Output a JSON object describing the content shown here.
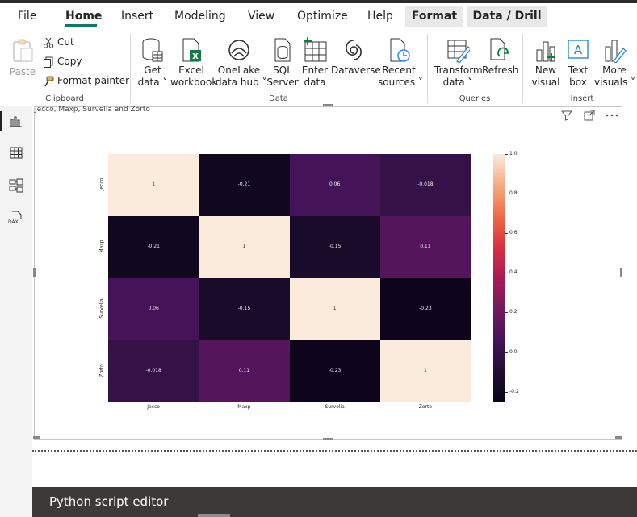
{
  "menu": {
    "tabs": [
      {
        "label": "File"
      },
      {
        "label": "Home"
      },
      {
        "label": "Insert"
      },
      {
        "label": "Modeling"
      },
      {
        "label": "View"
      },
      {
        "label": "Optimize"
      },
      {
        "label": "Help"
      },
      {
        "label": "Format"
      },
      {
        "label": "Data / Drill"
      }
    ],
    "active_tab": "Home"
  },
  "ribbon": {
    "clipboard": {
      "paste": "Paste",
      "cut": "Cut",
      "copy": "Copy",
      "format_painter": "Format painter",
      "group": "Clipboard"
    },
    "data": {
      "get_data_1": "Get",
      "get_data_2": "data",
      "excel_1": "Excel",
      "excel_2": "workbook",
      "onelake_1": "OneLake",
      "onelake_2": "data hub",
      "sql_1": "SQL",
      "sql_2": "Server",
      "enter_1": "Enter",
      "enter_2": "data",
      "dataverse": "Dataverse",
      "recent_1": "Recent",
      "recent_2": "sources",
      "group": "Data"
    },
    "queries": {
      "transform_1": "Transform",
      "transform_2": "data",
      "refresh": "Refresh",
      "group": "Queries"
    },
    "insert": {
      "new_visual_1": "New",
      "new_visual_2": "visual",
      "text_box_1": "Text",
      "text_box_2": "box",
      "more_1": "More",
      "more_2": "visuals",
      "group": "Insert"
    }
  },
  "visual": {
    "title": "Jecco, Maxp, Survelia and Zorto"
  },
  "python_editor": {
    "title": "Python script editor"
  },
  "colors": {
    "accent": "#117865",
    "editor_bg": "#3b3a39"
  },
  "chart_data": {
    "type": "heatmap",
    "title": "Jecco, Maxp, Survelia and Zorto",
    "x_labels": [
      "Jecco",
      "Maxp",
      "Survelia",
      "Zorto"
    ],
    "y_labels": [
      "Jecco",
      "Maxp",
      "Survelia",
      "Zorto"
    ],
    "values": [
      [
        1,
        -0.21,
        0.06,
        -0.018
      ],
      [
        -0.21,
        1,
        -0.15,
        0.11
      ],
      [
        0.06,
        -0.15,
        1,
        -0.23
      ],
      [
        -0.018,
        0.11,
        -0.23,
        1
      ]
    ],
    "value_labels": [
      [
        "1",
        "-0.21",
        "0.06",
        "-0.018"
      ],
      [
        "-0.21",
        "1",
        "-0.15",
        "0.11"
      ],
      [
        "0.06",
        "-0.15",
        "1",
        "-0.23"
      ],
      [
        "-0.018",
        "0.11",
        "-0.23",
        "1"
      ]
    ],
    "colorbar": {
      "range": [
        -0.25,
        1.0
      ],
      "ticks": [
        "1.0",
        "0.8",
        "0.6",
        "0.4",
        "0.2",
        "0.0",
        "-0.2"
      ],
      "tick_values": [
        1.0,
        0.8,
        0.6,
        0.4,
        0.2,
        0.0,
        -0.2
      ],
      "colormap": "rocket"
    }
  }
}
